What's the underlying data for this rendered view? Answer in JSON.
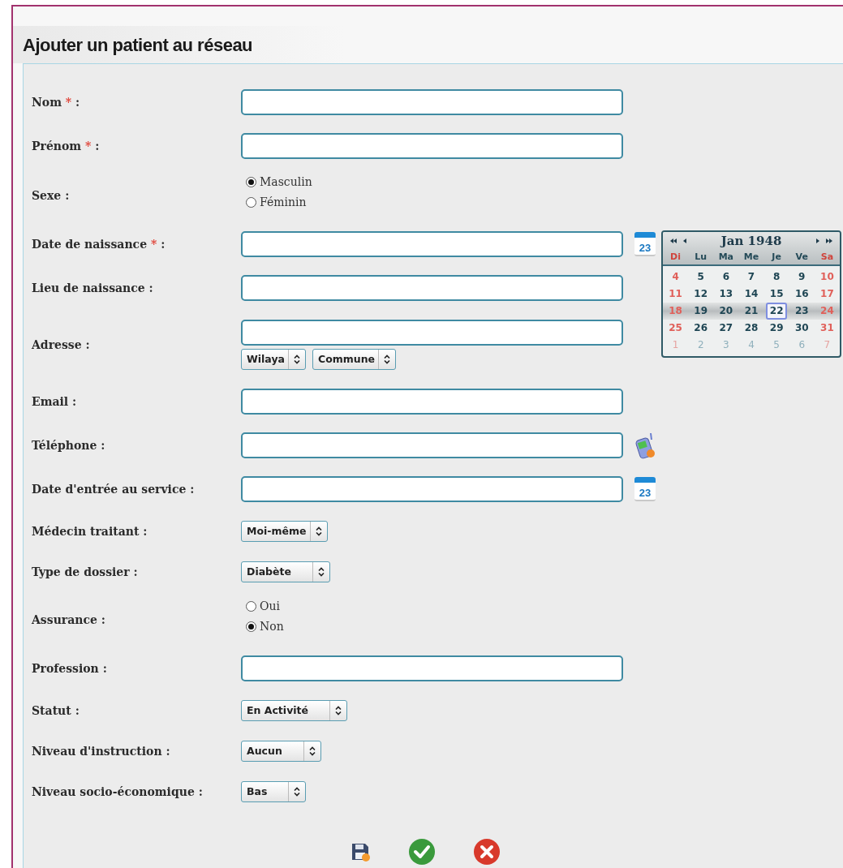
{
  "title": "Ajouter un patient au réseau",
  "form": {
    "required_mark": "*",
    "label_suffix": ":",
    "fields": [
      {
        "kind": "text",
        "label": "Nom",
        "required": true
      },
      {
        "kind": "text",
        "label": "Prénom",
        "required": true
      },
      {
        "kind": "radio",
        "label": "Sexe",
        "required": false,
        "options": [
          {
            "label": "Masculin",
            "selected": true
          },
          {
            "label": "Féminin",
            "selected": false
          }
        ]
      },
      {
        "kind": "text",
        "label": "Date de naissance",
        "required": true,
        "button": {
          "kind": "calendar",
          "text": "23"
        }
      },
      {
        "kind": "text",
        "label": "Lieu de naissance",
        "required": false
      },
      {
        "kind": "address",
        "label": "Adresse",
        "required": false,
        "selects": [
          "Wilaya",
          "Commune"
        ]
      },
      {
        "kind": "text",
        "label": "Email",
        "required": false
      },
      {
        "kind": "text",
        "label": "Téléphone",
        "required": false,
        "button": {
          "kind": "phone"
        }
      },
      {
        "kind": "text",
        "label": "Date d'entrée au service",
        "required": false,
        "button": {
          "kind": "calendar",
          "text": "23"
        }
      },
      {
        "kind": "select",
        "label": "Médecin traitant",
        "required": false,
        "value": "Moi-même"
      },
      {
        "kind": "select",
        "label": "Type de dossier",
        "required": false,
        "value": "Diabète"
      },
      {
        "kind": "radio",
        "label": "Assurance",
        "required": false,
        "options": [
          {
            "label": "Oui",
            "selected": false
          },
          {
            "label": "Non",
            "selected": true
          }
        ]
      },
      {
        "kind": "text",
        "label": "Profession",
        "required": false
      },
      {
        "kind": "select",
        "label": "Statut",
        "required": false,
        "value": "En Activité"
      },
      {
        "kind": "select",
        "label": "Niveau d'instruction",
        "required": false,
        "value": "Aucun"
      },
      {
        "kind": "select",
        "label": "Niveau socio-économique",
        "required": false,
        "value": "Bas"
      }
    ],
    "actions": [
      {
        "kind": "save"
      },
      {
        "kind": "confirm"
      },
      {
        "kind": "cancel"
      }
    ]
  },
  "calendar": {
    "month": "Jan 1948",
    "weekdays": [
      "Di",
      "Lu",
      "Ma",
      "Me",
      "Je",
      "Ve",
      "Sa"
    ],
    "weeks": [
      {
        "highlighted": false,
        "days": [
          {
            "day": "4",
            "selected": false,
            "other_month": false
          },
          {
            "day": "5",
            "selected": false,
            "other_month": false
          },
          {
            "day": "6",
            "selected": false,
            "other_month": false
          },
          {
            "day": "7",
            "selected": false,
            "other_month": false
          },
          {
            "day": "8",
            "selected": false,
            "other_month": false
          },
          {
            "day": "9",
            "selected": false,
            "other_month": false
          },
          {
            "day": "10",
            "selected": false,
            "other_month": false
          }
        ]
      },
      {
        "highlighted": false,
        "days": [
          {
            "day": "11",
            "selected": false,
            "other_month": false
          },
          {
            "day": "12",
            "selected": false,
            "other_month": false
          },
          {
            "day": "13",
            "selected": false,
            "other_month": false
          },
          {
            "day": "14",
            "selected": false,
            "other_month": false
          },
          {
            "day": "15",
            "selected": false,
            "other_month": false
          },
          {
            "day": "16",
            "selected": false,
            "other_month": false
          },
          {
            "day": "17",
            "selected": false,
            "other_month": false
          }
        ]
      },
      {
        "highlighted": true,
        "days": [
          {
            "day": "18",
            "selected": false,
            "other_month": false
          },
          {
            "day": "19",
            "selected": false,
            "other_month": false
          },
          {
            "day": "20",
            "selected": false,
            "other_month": false
          },
          {
            "day": "21",
            "selected": false,
            "other_month": false
          },
          {
            "day": "22",
            "selected": true,
            "other_month": false
          },
          {
            "day": "23",
            "selected": false,
            "other_month": false
          },
          {
            "day": "24",
            "selected": false,
            "other_month": false
          }
        ]
      },
      {
        "highlighted": false,
        "days": [
          {
            "day": "25",
            "selected": false,
            "other_month": false
          },
          {
            "day": "26",
            "selected": false,
            "other_month": false
          },
          {
            "day": "27",
            "selected": false,
            "other_month": false
          },
          {
            "day": "28",
            "selected": false,
            "other_month": false
          },
          {
            "day": "29",
            "selected": false,
            "other_month": false
          },
          {
            "day": "30",
            "selected": false,
            "other_month": false
          },
          {
            "day": "31",
            "selected": false,
            "other_month": false
          }
        ]
      },
      {
        "highlighted": false,
        "days": [
          {
            "day": "1",
            "selected": false,
            "other_month": true
          },
          {
            "day": "2",
            "selected": false,
            "other_month": true
          },
          {
            "day": "3",
            "selected": false,
            "other_month": true
          },
          {
            "day": "4",
            "selected": false,
            "other_month": true
          },
          {
            "day": "5",
            "selected": false,
            "other_month": true
          },
          {
            "day": "6",
            "selected": false,
            "other_month": true
          },
          {
            "day": "7",
            "selected": false,
            "other_month": true
          }
        ]
      }
    ]
  }
}
